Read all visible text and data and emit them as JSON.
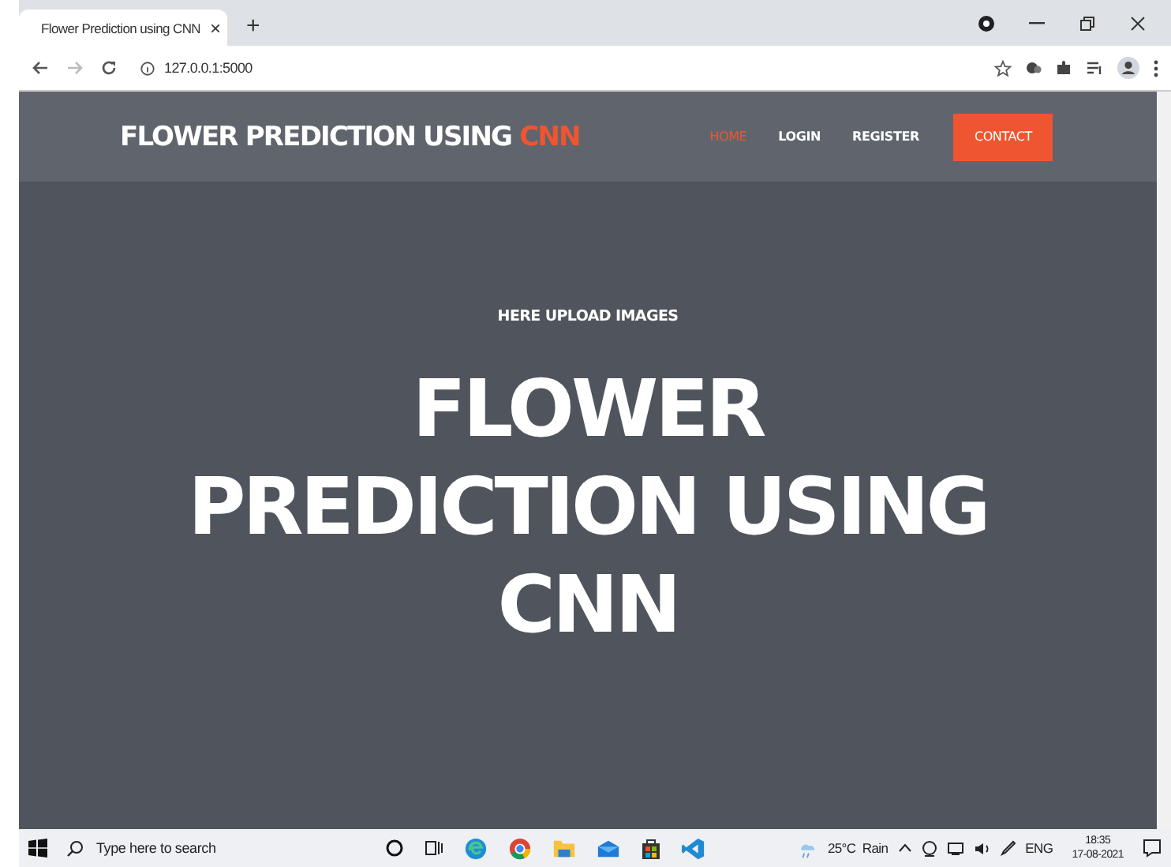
{
  "browser": {
    "tab_title": "Flower Prediction using CNN",
    "tab_close": "×",
    "new_tab": "+",
    "url": "127.0.0.1:5000"
  },
  "site": {
    "brand": "FLOWER PREDICTION USING ",
    "brand_highlight": "CNN",
    "nav": [
      {
        "label": "HOME",
        "kind": "link",
        "selected": true
      },
      {
        "label": "LOGIN",
        "kind": "link",
        "selected": false
      },
      {
        "label": "REGISTER",
        "kind": "link",
        "selected": false
      },
      {
        "label": "CONTACT",
        "kind": "button",
        "selected": false
      }
    ],
    "hero": {
      "subtitle": "HERE UPLOAD IMAGES",
      "title": "FLOWER PREDICTION USING CNN"
    }
  },
  "taskbar": {
    "search_placeholder": "Type here to search",
    "weather": "25°C  Rain",
    "language": "ENG",
    "time": "18:35",
    "date": "17-08-2021"
  }
}
